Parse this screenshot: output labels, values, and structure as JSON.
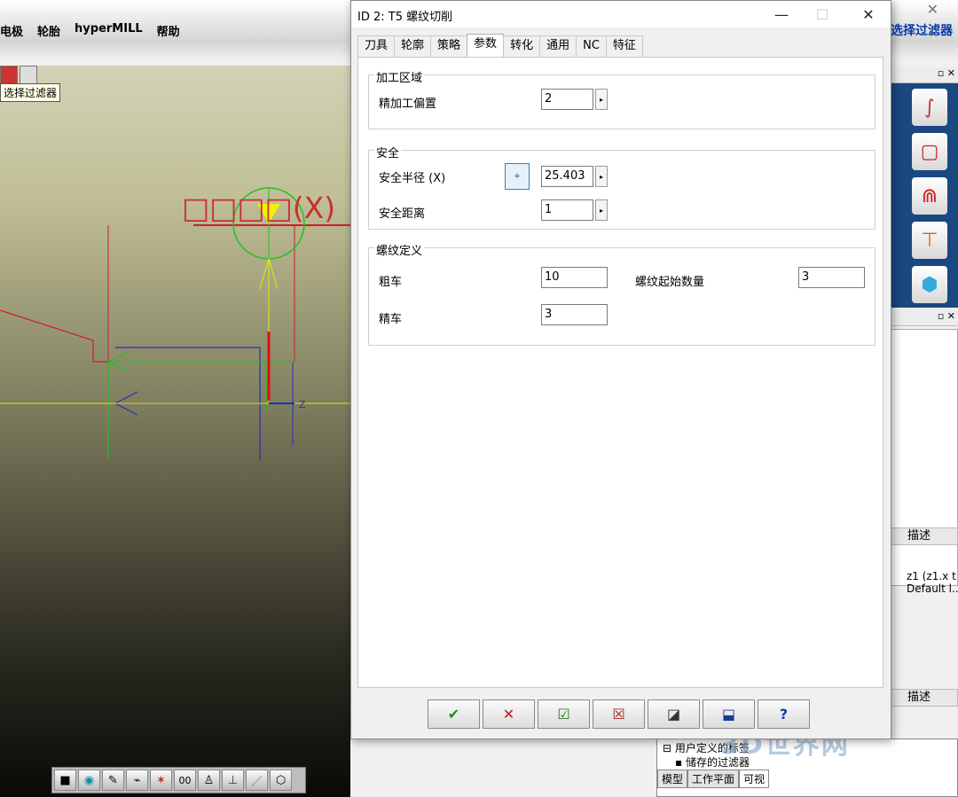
{
  "background_app": {
    "menu": [
      "电极",
      "轮胎",
      "hyperMILL",
      "帮助"
    ],
    "right_title": "选择过滤器",
    "filter_tooltip": "选择过滤器",
    "viewport_label": "□□□□(X)",
    "axis_label": "Z",
    "right_panel": {
      "column_header": "描述",
      "column_header_2": "描述",
      "desc_line1": "z1 (z1.x t",
      "desc_line2": "Default l..."
    },
    "tree": {
      "item1": "用户定义的标签",
      "item2": "储存的过滤器",
      "tabs": [
        "模型",
        "工作平面",
        "可视"
      ]
    },
    "watermark": "3D世界网"
  },
  "dialog": {
    "title": "ID 2: T5 螺纹切削",
    "tabs": [
      "刀具",
      "轮廓",
      "策略",
      "参数",
      "转化",
      "通用",
      "NC",
      "特征"
    ],
    "active_tab": "参数",
    "groups": {
      "machining_area": {
        "title": "加工区域",
        "finish_offset_label": "精加工偏置",
        "finish_offset_value": "2"
      },
      "safety": {
        "title": "安全",
        "safety_radius_label": "安全半径 (X)",
        "safety_radius_value": "25.403",
        "safety_distance_label": "安全距离",
        "safety_distance_value": "1"
      },
      "thread_def": {
        "title": "螺纹定义",
        "rough_label": "粗车",
        "rough_value": "10",
        "finish_label": "精车",
        "finish_value": "3",
        "start_count_label": "螺纹起始数量",
        "start_count_value": "3"
      }
    },
    "buttons": [
      {
        "name": "ok-button",
        "glyph": "✔",
        "color": "#1e8a1e"
      },
      {
        "name": "cancel-button",
        "glyph": "✕",
        "color": "#c01818"
      },
      {
        "name": "calculate-button",
        "glyph": "☑",
        "color": "#1e7a1e"
      },
      {
        "name": "discard-button",
        "glyph": "☒",
        "color": "#a01818"
      },
      {
        "name": "preview-button",
        "glyph": "◪",
        "color": "#333333"
      },
      {
        "name": "save-button",
        "glyph": "⬓",
        "color": "#1a3a9a"
      },
      {
        "name": "help-button",
        "glyph": "?",
        "color": "#1a3aa8"
      }
    ]
  }
}
